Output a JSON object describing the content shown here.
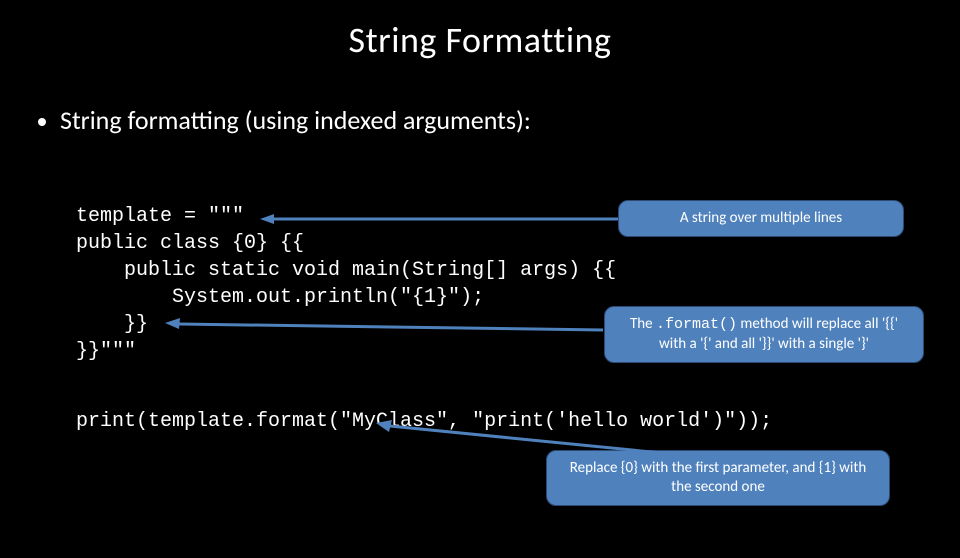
{
  "title": "String Formatting",
  "bullet": "String formatting (using indexed arguments):",
  "code": {
    "l1": "template = \"\"\"",
    "l2": "public class {0} {{",
    "l3": "    public static void main(String[] args) {{",
    "l4": "        System.out.println(\"{1}\");",
    "l5": "    }}",
    "l6": "}}\"\"\""
  },
  "code_print": "print(template.format(\"MyClass\", \"print('hello world')\"));",
  "callouts": {
    "c1": "A string over multiple lines",
    "c2_pre": "The ",
    "c2_mono": ".format()",
    "c2_post": " method will replace all '{{' with a '{' and all '}}' with a single '}'",
    "c3": "Replace {0} with the first parameter, and {1} with the second one"
  }
}
